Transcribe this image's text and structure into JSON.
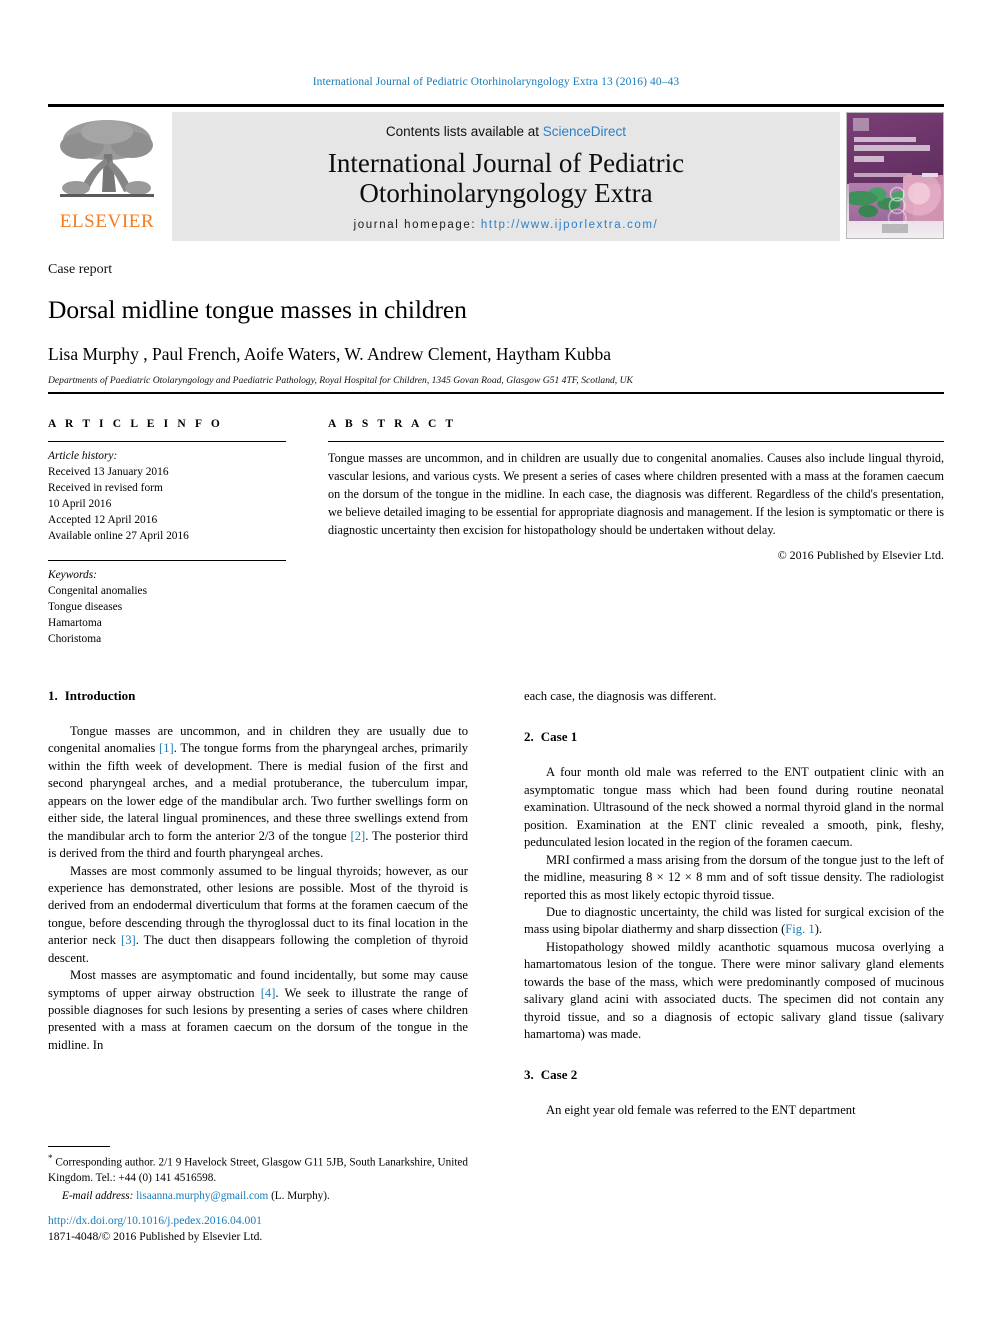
{
  "running_head": "International Journal of Pediatric Otorhinolaryngology Extra 13 (2016) 40–43",
  "masthead": {
    "publisher_logo_text": "ELSEVIER",
    "contents_prefix": "Contents lists available at",
    "contents_link": "ScienceDirect",
    "journal_title_line1": "International Journal of Pediatric",
    "journal_title_line2": "Otorhinolaryngology Extra",
    "homepage_label": "journal homepage:",
    "homepage_url": "http://www.ijporlextra.com/",
    "cover_thumbnail_alt": "journal-cover-thumbnail"
  },
  "article": {
    "type": "Case report",
    "title": "Dorsal midline tongue masses in children",
    "authors": "Lisa Murphy , Paul French, Aoife Waters, W. Andrew Clement, Haytham Kubba",
    "author_marker": "*",
    "affiliation": "Departments of Paediatric Otolaryngology and Paediatric Pathology, Royal Hospital for Children, 1345 Govan Road, Glasgow G51 4TF, Scotland, UK"
  },
  "article_info": {
    "heading": "A R T I C L E   I N F O",
    "history_label": "Article history:",
    "history": [
      "Received 13 January 2016",
      "Received in revised form",
      "10 April 2016",
      "Accepted 12 April 2016",
      "Available online 27 April 2016"
    ],
    "keywords_label": "Keywords:",
    "keywords": [
      "Congenital anomalies",
      "Tongue diseases",
      "Hamartoma",
      "Choristoma"
    ]
  },
  "abstract": {
    "heading": "A B S T R A C T",
    "text": "Tongue masses are uncommon, and in children are usually due to congenital anomalies. Causes also include lingual thyroid, vascular lesions, and various cysts. We present a series of cases where children presented with a mass at the foramen caecum on the dorsum of the tongue in the midline. In each case, the diagnosis was different. Regardless of the child's presentation, we believe detailed imaging to be essential for appropriate diagnosis and management. If the lesion is symptomatic or there is diagnostic uncertainty then excision for histopathology should be undertaken without delay.",
    "copyright": "© 2016 Published by Elsevier Ltd."
  },
  "body": {
    "left": {
      "section_number": "1.",
      "section_title": "Introduction",
      "p1_a": "Tongue masses are uncommon, and in children they are usually due to congenital anomalies ",
      "p1_ref1": "[1]",
      "p1_b": ". The tongue forms from the pharyngeal arches, primarily within the fifth week of development. There is medial fusion of the first and second pharyngeal arches, and a medial protuberance, the tuberculum impar, appears on the lower edge of the mandibular arch. Two further swellings form on either side, the lateral lingual prominences, and these three swellings extend from the mandibular arch to form the anterior 2/3 of the tongue ",
      "p1_ref2": "[2]",
      "p1_c": ". The posterior third is derived from the third and fourth pharyngeal arches.",
      "p2_a": "Masses are most commonly assumed to be lingual thyroids; however, as our experience has demonstrated, other lesions are possible. Most of the thyroid is derived from an endodermal diverticulum that forms at the foramen caecum of the tongue, before descending through the thyroglossal duct to its final location in the anterior neck ",
      "p2_ref": "[3]",
      "p2_b": ". The duct then disappears following the completion of thyroid descent.",
      "p3_a": "Most masses are asymptomatic and found incidentally, but some may cause symptoms of upper airway obstruction ",
      "p3_ref": "[4]",
      "p3_b": ". We seek to illustrate the range of possible diagnoses for such lesions by presenting a series of cases where children presented with a mass at foramen caecum on the dorsum of the tongue in the midline. In"
    },
    "right": {
      "carryover": "each case, the diagnosis was different.",
      "case1_number": "2.",
      "case1_title": "Case 1",
      "case1_p1": "A four month old male was referred to the ENT outpatient clinic with an asymptomatic tongue mass which had been found during routine neonatal examination. Ultrasound of the neck showed a normal thyroid gland in the normal position. Examination at the ENT clinic revealed a smooth, pink, fleshy, pedunculated lesion located in the region of the foramen caecum.",
      "case1_p2": "MRI confirmed a mass arising from the dorsum of the tongue just to the left of the midline, measuring 8 × 12 × 8 mm and of soft tissue density. The radiologist reported this as most likely ectopic thyroid tissue.",
      "case1_p3_a": "Due to diagnostic uncertainty, the child was listed for surgical excision of the mass using bipolar diathermy and sharp dissection (",
      "case1_p3_ref": "Fig. 1",
      "case1_p3_b": ").",
      "case1_p4": "Histopathology showed mildly acanthotic squamous mucosa overlying a hamartomatous lesion of the tongue. There were minor salivary gland elements towards the base of the mass, which were predominantly composed of mucinous salivary gland acini with associated ducts. The specimen did not contain any thyroid tissue, and so a diagnosis of ectopic salivary gland tissue (salivary hamartoma) was made.",
      "case2_number": "3.",
      "case2_title": "Case 2",
      "case2_p1": "An eight year old female was referred to the ENT department"
    }
  },
  "footnote": {
    "marker": "*",
    "text": " Corresponding author. 2/1 9 Havelock Street, Glasgow G11 5JB, South Lanarkshire, United Kingdom. Tel.: +44 (0) 141 4516598.",
    "email_label": "E-mail address:",
    "email": "lisaanna.murphy@gmail.com",
    "email_owner": "(L. Murphy)."
  },
  "doi": {
    "url": "http://dx.doi.org/10.1016/j.pedex.2016.04.001",
    "issn_line": "1871-4048/© 2016 Published by Elsevier Ltd."
  },
  "colors": {
    "link": "#1a7bb9",
    "sciencedirect": "#2a7fc9",
    "elsevier_orange": "#f47c20",
    "band_grey": "#e6e6e6"
  }
}
